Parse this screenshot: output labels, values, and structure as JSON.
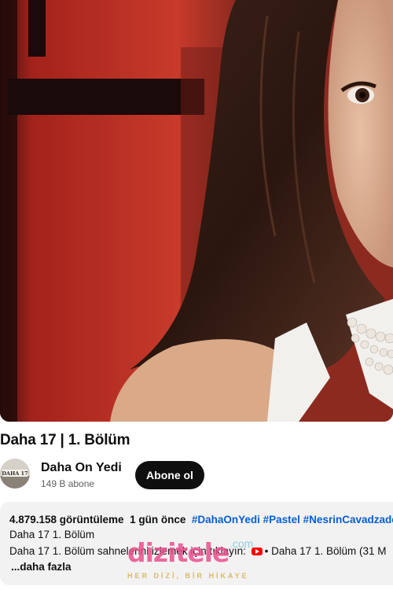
{
  "video": {
    "thumbnail": "woman-with-dark-hair-and-pearl-necklace"
  },
  "title": "Daha 17 | 1. Bölüm",
  "channel": {
    "avatar_label": "DAHA 17",
    "name": "Daha On Yedi",
    "subscribers": "149 B abone",
    "subscribe_label": "Abone ol"
  },
  "description": {
    "views": "4.879.158 görüntüleme",
    "time": "1 gün önce",
    "hashtags": "#DahaOnYedi #Pastel #NesrinCavadzade",
    "line2": "Daha 17 1. Bölüm",
    "line3_start": "Daha 17 1. Bölüm sahnelerini izlemek için tıklayın:",
    "line3_end": "• Daha 17 1. Bölüm (31 M",
    "more": "...daha fazla",
    "icon": "youtube-icon"
  },
  "watermark": {
    "logo": "dizitele",
    "domain": ".com",
    "tagline": "HER DİZİ, BİR HİKAYE"
  },
  "colors": {
    "accent_button": "#0f0f0f",
    "hashtag": "#065fd4",
    "panel": "#f2f2f2"
  }
}
